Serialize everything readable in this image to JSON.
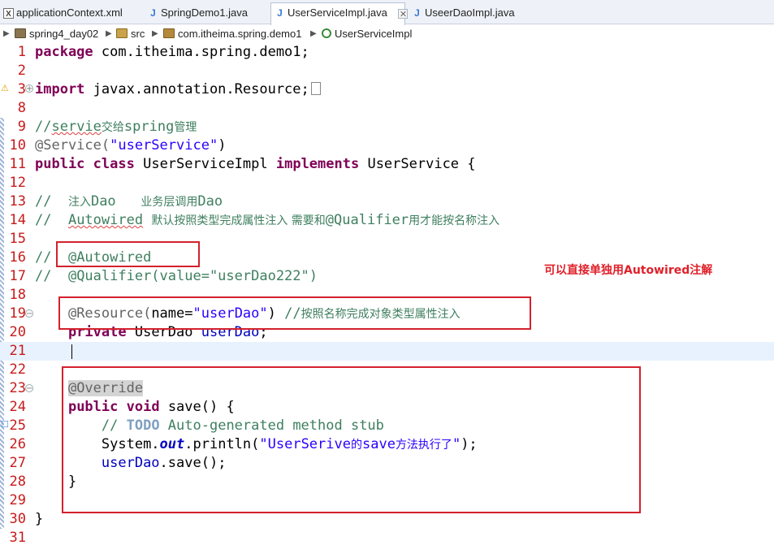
{
  "tabs": [
    {
      "label": "applicationContextXml",
      "text": "applicationContext.xml",
      "icon": "xml-file-icon",
      "active": false
    },
    {
      "label": "SpringDemo1",
      "text": "SpringDemo1.java",
      "icon": "java-file-icon",
      "active": false
    },
    {
      "label": "UserServiceImpl",
      "text": "UserServiceImpl.java",
      "icon": "java-file-icon",
      "active": true,
      "close": "✕"
    },
    {
      "label": "UseerDaoImpl",
      "text": "UseerDaoImpl.java",
      "icon": "java-file-icon",
      "active": false
    }
  ],
  "breadcrumb": {
    "project": "spring4_day02",
    "src": "src",
    "package": "com.itheima.spring.demo1",
    "class": "UserServiceImpl"
  },
  "editor": {
    "line_numbers": [
      "1",
      "2",
      "3",
      "8",
      "9",
      "10",
      "11",
      "12",
      "13",
      "14",
      "15",
      "16",
      "17",
      "18",
      "19",
      "20",
      "21",
      "22",
      "23",
      "24",
      "25",
      "26",
      "27",
      "28",
      "29",
      "30",
      "31"
    ],
    "current_line": "21",
    "code": {
      "l1": [
        "package",
        " com.itheima.spring.demo1;"
      ],
      "l3": [
        "import",
        " javax.annotation.Resource;"
      ],
      "l9": [
        "//",
        "servie",
        "交给",
        "spring",
        "管理"
      ],
      "l10": [
        "@Service(",
        "\"userService\"",
        ")"
      ],
      "l11": [
        "public",
        " ",
        "class",
        " UserServiceImpl ",
        "implements",
        " UserService {"
      ],
      "l13": [
        "//  ",
        "注入",
        "Dao",
        "   ",
        "业务层调用",
        "Dao"
      ],
      "l14": [
        "//  ",
        "Autowired",
        " ",
        "默认按照类型完成属性注入 需要和",
        "@Qualifier",
        "用才能按名称注入"
      ],
      "l16": [
        "//  ",
        "@Autowired"
      ],
      "l17": [
        "//  ",
        "@Qualifier(value=\"userDao222\")"
      ],
      "l19": [
        "    ",
        "@Resource(",
        "name",
        "=",
        "\"userDao\"",
        ") ",
        "//",
        "按照名称完成对象类型属性注入"
      ],
      "l20": [
        "    ",
        "private",
        " UserDao ",
        "userDao",
        ";"
      ],
      "l23": [
        "    ",
        "@Override"
      ],
      "l24": [
        "    ",
        "public",
        " ",
        "void",
        " save() {"
      ],
      "l25": [
        "        ",
        "// ",
        "TODO",
        " Auto-generated method stub"
      ],
      "l26": [
        "        ",
        "System.",
        "out",
        ".println(",
        "\"UserSerive",
        "的",
        "save",
        "方法执行了",
        "\"",
        ");"
      ],
      "l27": [
        "        ",
        "userDao",
        ".save();"
      ],
      "l28": [
        "    ",
        "}"
      ],
      "l30": [
        "}"
      ]
    }
  },
  "annotation_note": "可以直接单独用Autowired注解",
  "colors": {
    "keyword": "#7f0055",
    "string": "#2a00ff",
    "comment": "#3f7f5f",
    "annotation": "#646464",
    "line_number": "#c71b1b",
    "highlight_box": "#d3212d"
  }
}
